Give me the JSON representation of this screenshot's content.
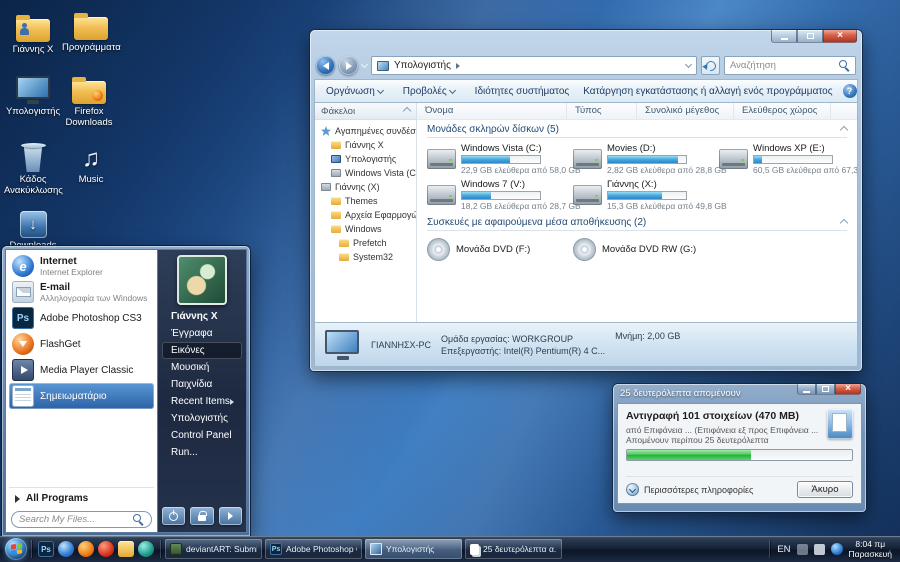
{
  "icons": {
    "ie_glyph": "e",
    "ps_glyph": "Ps"
  },
  "desktop": {
    "icons": [
      {
        "label": "Γιάννης Χ"
      },
      {
        "label": "Προγράμματα"
      },
      {
        "label": "Υπολογιστής"
      },
      {
        "label": "Firefox Downloads"
      },
      {
        "label": "Κάδος Ανακύκλωσης"
      },
      {
        "label": "Music"
      },
      {
        "label": "Downloads"
      }
    ]
  },
  "explorer": {
    "breadcrumb": "Υπολογιστής",
    "search_placeholder": "Αναζήτηση",
    "toolbar": {
      "organize": "Οργάνωση",
      "views": "Προβολές",
      "system_properties": "Ιδιότητες συστήματος",
      "uninstall": "Κατάργηση εγκατάστασης ή αλλαγή ενός προγράμματος",
      "help_glyph": "?"
    },
    "sidebar": {
      "header": "Φάκελοι",
      "items": [
        {
          "label": "Αγαπημένες συνδέσεις"
        },
        {
          "label": "Γιάννης Χ"
        },
        {
          "label": "Υπολογιστής"
        },
        {
          "label": "Windows Vista (C)"
        },
        {
          "label": "Γιάννης (Χ)"
        },
        {
          "label": "Themes"
        },
        {
          "label": "Αρχεία Εφαρμογών"
        },
        {
          "label": "Windows"
        },
        {
          "label": "Prefetch"
        },
        {
          "label": "System32"
        }
      ]
    },
    "columns": [
      "Όνομα",
      "Τύπος",
      "Συνολικό μέγεθος",
      "Ελεύθερος χώρος"
    ],
    "group_drives": "Μονάδες σκληρών δίσκων (5)",
    "group_removable": "Συσκευές με αφαιρούμενα μέσα αποθήκευσης (2)",
    "drives": [
      {
        "name": "Windows Vista (C:)",
        "free": "22,9 GB ελεύθερα από 58,0 GB",
        "used_pct": 61
      },
      {
        "name": "Movies (D:)",
        "free": "2,82 GB ελεύθερα από 28,8 GB",
        "used_pct": 90
      },
      {
        "name": "Windows XP (E:)",
        "free": "60,5 GB ελεύθερα από 67,3 GB",
        "used_pct": 10
      },
      {
        "name": "Windows 7 (V:)",
        "free": "18,2 GB ελεύθερα από 28,7 GB",
        "used_pct": 37
      },
      {
        "name": "Γιάννης (Χ:)",
        "free": "15,3 GB ελεύθερα από 49,8 GB",
        "used_pct": 69
      }
    ],
    "devices": [
      {
        "name": "Μονάδα DVD (F:)"
      },
      {
        "name": "Μονάδα DVD RW (G:)"
      }
    ],
    "details": {
      "computer_name": "ΓΙΑΝΝΗΣΧ-PC",
      "workgroup": "Ομάδα εργασίας: WORKGROUP",
      "memory": "Μνήμη: 2,00 GB",
      "processor": "Επεξεργαστής: Intel(R) Pentium(R) 4 C..."
    }
  },
  "start_menu": {
    "left_items": [
      {
        "title": "Internet",
        "subtitle": "Internet Explorer"
      },
      {
        "title": "E-mail",
        "subtitle": "Αλληλογραφία των Windows"
      },
      {
        "title": "Adobe Photoshop CS3"
      },
      {
        "title": "FlashGet"
      },
      {
        "title": "Media Player Classic"
      },
      {
        "title": "Σημειωματάριο"
      }
    ],
    "all_programs": "All Programs",
    "search_placeholder": "Search My Files...",
    "right_items": [
      "Γιάννης Χ",
      "Έγγραφα",
      "Εικόνες",
      "Μουσική",
      "Παιχνίδια",
      "Recent Items",
      "Υπολογιστής",
      "Control Panel",
      "Run..."
    ]
  },
  "copy_dialog": {
    "title": "25 δευτερόλεπτα απομένουν",
    "heading": "Αντιγραφή 101 στοιχείων (470 MB)",
    "from_to": "από Επιφάνεια ... (Επιφάνεια εξ προς Επιφάνεια ... (Επιφάνεια εξ",
    "remaining": "Απομένουν περίπου 25 δευτερόλεπτα",
    "progress_pct": 55,
    "more_info": "Περισσότερες πληροφορίες",
    "cancel": "Άκυρο"
  },
  "taskbar": {
    "tasks": [
      {
        "label": "deviantART: Submis..."
      },
      {
        "label": "Adobe Photoshop C..."
      },
      {
        "label": "Υπολογιστής"
      },
      {
        "label": "25 δευτερόλεπτα α..."
      }
    ],
    "tray": {
      "lang": "EN",
      "time": "8:04 πμ",
      "day": "Παρασκευή"
    }
  }
}
